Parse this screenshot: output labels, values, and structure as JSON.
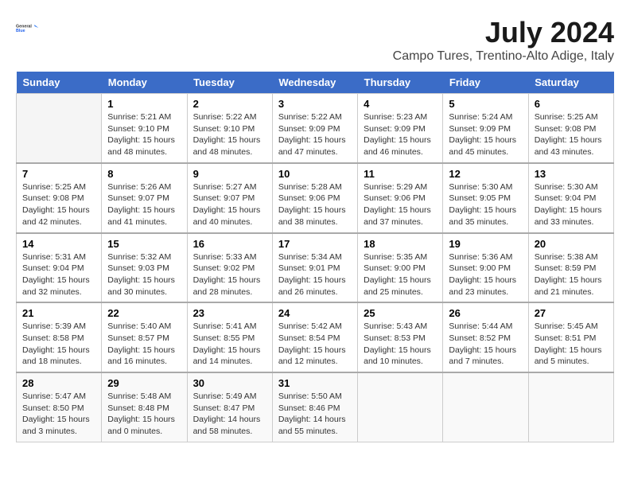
{
  "header": {
    "logo_line1": "General",
    "logo_line2": "Blue",
    "title": "July 2024",
    "location": "Campo Tures, Trentino-Alto Adige, Italy"
  },
  "weekdays": [
    "Sunday",
    "Monday",
    "Tuesday",
    "Wednesday",
    "Thursday",
    "Friday",
    "Saturday"
  ],
  "weeks": [
    [
      {
        "day": null,
        "info": null
      },
      {
        "day": "1",
        "info": "Sunrise: 5:21 AM\nSunset: 9:10 PM\nDaylight: 15 hours\nand 48 minutes."
      },
      {
        "day": "2",
        "info": "Sunrise: 5:22 AM\nSunset: 9:10 PM\nDaylight: 15 hours\nand 48 minutes."
      },
      {
        "day": "3",
        "info": "Sunrise: 5:22 AM\nSunset: 9:09 PM\nDaylight: 15 hours\nand 47 minutes."
      },
      {
        "day": "4",
        "info": "Sunrise: 5:23 AM\nSunset: 9:09 PM\nDaylight: 15 hours\nand 46 minutes."
      },
      {
        "day": "5",
        "info": "Sunrise: 5:24 AM\nSunset: 9:09 PM\nDaylight: 15 hours\nand 45 minutes."
      },
      {
        "day": "6",
        "info": "Sunrise: 5:25 AM\nSunset: 9:08 PM\nDaylight: 15 hours\nand 43 minutes."
      }
    ],
    [
      {
        "day": "7",
        "info": "Sunrise: 5:25 AM\nSunset: 9:08 PM\nDaylight: 15 hours\nand 42 minutes."
      },
      {
        "day": "8",
        "info": "Sunrise: 5:26 AM\nSunset: 9:07 PM\nDaylight: 15 hours\nand 41 minutes."
      },
      {
        "day": "9",
        "info": "Sunrise: 5:27 AM\nSunset: 9:07 PM\nDaylight: 15 hours\nand 40 minutes."
      },
      {
        "day": "10",
        "info": "Sunrise: 5:28 AM\nSunset: 9:06 PM\nDaylight: 15 hours\nand 38 minutes."
      },
      {
        "day": "11",
        "info": "Sunrise: 5:29 AM\nSunset: 9:06 PM\nDaylight: 15 hours\nand 37 minutes."
      },
      {
        "day": "12",
        "info": "Sunrise: 5:30 AM\nSunset: 9:05 PM\nDaylight: 15 hours\nand 35 minutes."
      },
      {
        "day": "13",
        "info": "Sunrise: 5:30 AM\nSunset: 9:04 PM\nDaylight: 15 hours\nand 33 minutes."
      }
    ],
    [
      {
        "day": "14",
        "info": "Sunrise: 5:31 AM\nSunset: 9:04 PM\nDaylight: 15 hours\nand 32 minutes."
      },
      {
        "day": "15",
        "info": "Sunrise: 5:32 AM\nSunset: 9:03 PM\nDaylight: 15 hours\nand 30 minutes."
      },
      {
        "day": "16",
        "info": "Sunrise: 5:33 AM\nSunset: 9:02 PM\nDaylight: 15 hours\nand 28 minutes."
      },
      {
        "day": "17",
        "info": "Sunrise: 5:34 AM\nSunset: 9:01 PM\nDaylight: 15 hours\nand 26 minutes."
      },
      {
        "day": "18",
        "info": "Sunrise: 5:35 AM\nSunset: 9:00 PM\nDaylight: 15 hours\nand 25 minutes."
      },
      {
        "day": "19",
        "info": "Sunrise: 5:36 AM\nSunset: 9:00 PM\nDaylight: 15 hours\nand 23 minutes."
      },
      {
        "day": "20",
        "info": "Sunrise: 5:38 AM\nSunset: 8:59 PM\nDaylight: 15 hours\nand 21 minutes."
      }
    ],
    [
      {
        "day": "21",
        "info": "Sunrise: 5:39 AM\nSunset: 8:58 PM\nDaylight: 15 hours\nand 18 minutes."
      },
      {
        "day": "22",
        "info": "Sunrise: 5:40 AM\nSunset: 8:57 PM\nDaylight: 15 hours\nand 16 minutes."
      },
      {
        "day": "23",
        "info": "Sunrise: 5:41 AM\nSunset: 8:55 PM\nDaylight: 15 hours\nand 14 minutes."
      },
      {
        "day": "24",
        "info": "Sunrise: 5:42 AM\nSunset: 8:54 PM\nDaylight: 15 hours\nand 12 minutes."
      },
      {
        "day": "25",
        "info": "Sunrise: 5:43 AM\nSunset: 8:53 PM\nDaylight: 15 hours\nand 10 minutes."
      },
      {
        "day": "26",
        "info": "Sunrise: 5:44 AM\nSunset: 8:52 PM\nDaylight: 15 hours\nand 7 minutes."
      },
      {
        "day": "27",
        "info": "Sunrise: 5:45 AM\nSunset: 8:51 PM\nDaylight: 15 hours\nand 5 minutes."
      }
    ],
    [
      {
        "day": "28",
        "info": "Sunrise: 5:47 AM\nSunset: 8:50 PM\nDaylight: 15 hours\nand 3 minutes."
      },
      {
        "day": "29",
        "info": "Sunrise: 5:48 AM\nSunset: 8:48 PM\nDaylight: 15 hours\nand 0 minutes."
      },
      {
        "day": "30",
        "info": "Sunrise: 5:49 AM\nSunset: 8:47 PM\nDaylight: 14 hours\nand 58 minutes."
      },
      {
        "day": "31",
        "info": "Sunrise: 5:50 AM\nSunset: 8:46 PM\nDaylight: 14 hours\nand 55 minutes."
      },
      {
        "day": null,
        "info": null
      },
      {
        "day": null,
        "info": null
      },
      {
        "day": null,
        "info": null
      }
    ]
  ]
}
